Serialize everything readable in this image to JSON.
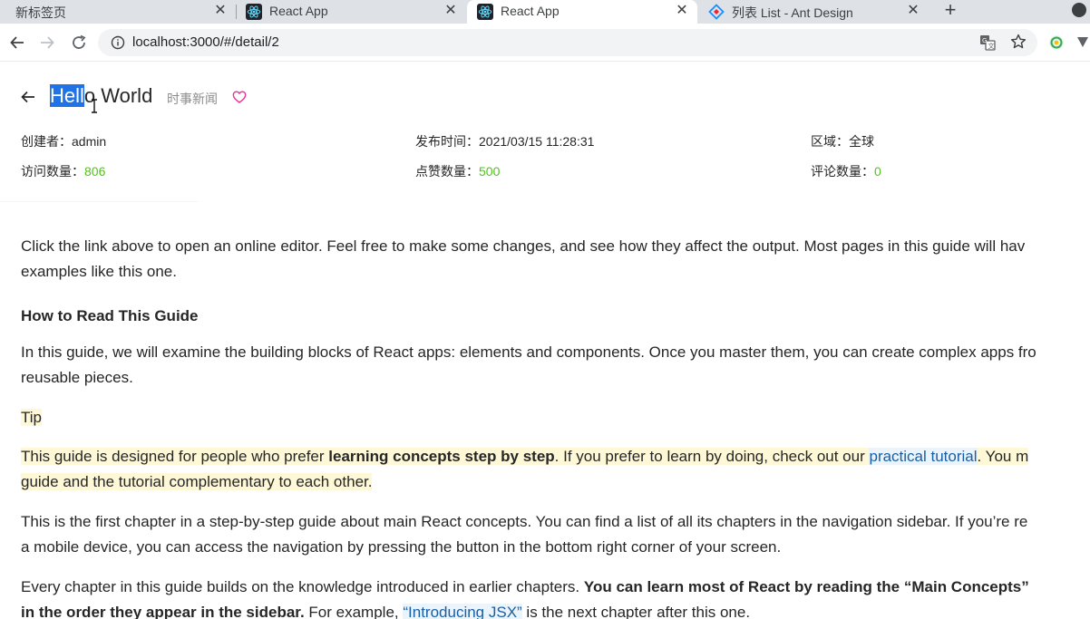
{
  "browser": {
    "tabs": [
      {
        "title": "新标签页",
        "close": "✕",
        "icon": "none",
        "active": false
      },
      {
        "title": "React App",
        "close": "✕",
        "icon": "react-icon",
        "active": false
      },
      {
        "title": "React App",
        "close": "✕",
        "icon": "react-icon",
        "active": true
      },
      {
        "title": "列表 List - Ant Design",
        "close": "✕",
        "icon": "ant-design-icon",
        "active": false
      }
    ],
    "new_tab": "+",
    "address": "localhost:3000/#/detail/2",
    "colors": {
      "tab_strip": "#dee1e6",
      "react": "#61dafb",
      "ant_blue": "#1890ff",
      "ant_red": "#f5222d"
    }
  },
  "page": {
    "header": {
      "title_selected": "Hell",
      "title_rest": "o World",
      "subtitle": "时事新闻",
      "icons": [
        "arrow-left-icon",
        "heart-icon"
      ],
      "heart_color": "#eb2f96"
    },
    "descriptions": {
      "creator_label": "创建者：",
      "creator_value": "admin",
      "publish_label": "发布时间：",
      "publish_value": "2021/03/15 11:28:31",
      "region_label": "区域：",
      "region_value": "全球",
      "visits_label": "访问数量：",
      "visits_value": "806",
      "likes_label": "点赞数量：",
      "likes_value": "500",
      "comments_label": "评论数量：",
      "comments_value": "0",
      "value_color": "#52c41a"
    },
    "content": {
      "p1": "Click the link above to open an online editor. Feel free to make some changes, and see how they affect the output. Most pages in this guide will hav",
      "p1_cont": "examples like this one.",
      "h1": "How to Read This Guide",
      "p2": "In this guide, we will examine the building blocks of React apps: elements and components. Once you master them, you can create complex apps fro",
      "p2_cont": "reusable pieces.",
      "tip": "Tip",
      "tip_a": "This guide is designed for people who prefer ",
      "tip_bold": "learning concepts step by step",
      "tip_b": ". If you prefer to learn by doing, check out our ",
      "tip_link": "practical tutorial",
      "tip_c": ". You m",
      "tip_cont": "guide and the tutorial complementary to each other.",
      "p3": "This is the first chapter in a step-by-step guide about main React concepts. You can find a list of all its chapters in the navigation sidebar. If you’re re",
      "p3_cont": "a mobile device, you can access the navigation by pressing the button in the bottom right corner of your screen.",
      "p4_a": "Every chapter in this guide builds on the knowledge introduced in earlier chapters. ",
      "p4_bold": "You can learn most of React by reading the “Main Concepts”",
      "p4_bold2": "in the order they appear in the sidebar.",
      "p4_b": " For example, ",
      "p4_link": "“Introducing JSX”",
      "p4_c": " is the next chapter after this one.",
      "highlight_color": "#fff8d6"
    }
  }
}
